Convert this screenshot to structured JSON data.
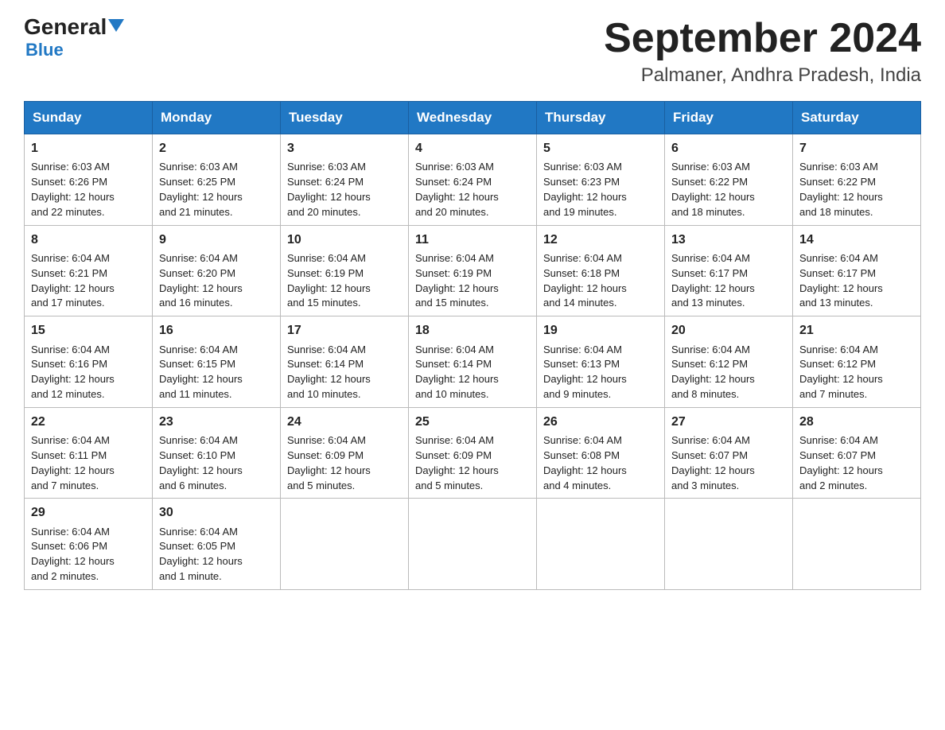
{
  "header": {
    "logo_general": "General",
    "logo_blue": "Blue",
    "month_title": "September 2024",
    "location": "Palmaner, Andhra Pradesh, India"
  },
  "days_of_week": [
    "Sunday",
    "Monday",
    "Tuesday",
    "Wednesday",
    "Thursday",
    "Friday",
    "Saturday"
  ],
  "weeks": [
    [
      {
        "day": "1",
        "sunrise": "6:03 AM",
        "sunset": "6:26 PM",
        "daylight": "12 hours and 22 minutes."
      },
      {
        "day": "2",
        "sunrise": "6:03 AM",
        "sunset": "6:25 PM",
        "daylight": "12 hours and 21 minutes."
      },
      {
        "day": "3",
        "sunrise": "6:03 AM",
        "sunset": "6:24 PM",
        "daylight": "12 hours and 20 minutes."
      },
      {
        "day": "4",
        "sunrise": "6:03 AM",
        "sunset": "6:24 PM",
        "daylight": "12 hours and 20 minutes."
      },
      {
        "day": "5",
        "sunrise": "6:03 AM",
        "sunset": "6:23 PM",
        "daylight": "12 hours and 19 minutes."
      },
      {
        "day": "6",
        "sunrise": "6:03 AM",
        "sunset": "6:22 PM",
        "daylight": "12 hours and 18 minutes."
      },
      {
        "day": "7",
        "sunrise": "6:03 AM",
        "sunset": "6:22 PM",
        "daylight": "12 hours and 18 minutes."
      }
    ],
    [
      {
        "day": "8",
        "sunrise": "6:04 AM",
        "sunset": "6:21 PM",
        "daylight": "12 hours and 17 minutes."
      },
      {
        "day": "9",
        "sunrise": "6:04 AM",
        "sunset": "6:20 PM",
        "daylight": "12 hours and 16 minutes."
      },
      {
        "day": "10",
        "sunrise": "6:04 AM",
        "sunset": "6:19 PM",
        "daylight": "12 hours and 15 minutes."
      },
      {
        "day": "11",
        "sunrise": "6:04 AM",
        "sunset": "6:19 PM",
        "daylight": "12 hours and 15 minutes."
      },
      {
        "day": "12",
        "sunrise": "6:04 AM",
        "sunset": "6:18 PM",
        "daylight": "12 hours and 14 minutes."
      },
      {
        "day": "13",
        "sunrise": "6:04 AM",
        "sunset": "6:17 PM",
        "daylight": "12 hours and 13 minutes."
      },
      {
        "day": "14",
        "sunrise": "6:04 AM",
        "sunset": "6:17 PM",
        "daylight": "12 hours and 13 minutes."
      }
    ],
    [
      {
        "day": "15",
        "sunrise": "6:04 AM",
        "sunset": "6:16 PM",
        "daylight": "12 hours and 12 minutes."
      },
      {
        "day": "16",
        "sunrise": "6:04 AM",
        "sunset": "6:15 PM",
        "daylight": "12 hours and 11 minutes."
      },
      {
        "day": "17",
        "sunrise": "6:04 AM",
        "sunset": "6:14 PM",
        "daylight": "12 hours and 10 minutes."
      },
      {
        "day": "18",
        "sunrise": "6:04 AM",
        "sunset": "6:14 PM",
        "daylight": "12 hours and 10 minutes."
      },
      {
        "day": "19",
        "sunrise": "6:04 AM",
        "sunset": "6:13 PM",
        "daylight": "12 hours and 9 minutes."
      },
      {
        "day": "20",
        "sunrise": "6:04 AM",
        "sunset": "6:12 PM",
        "daylight": "12 hours and 8 minutes."
      },
      {
        "day": "21",
        "sunrise": "6:04 AM",
        "sunset": "6:12 PM",
        "daylight": "12 hours and 7 minutes."
      }
    ],
    [
      {
        "day": "22",
        "sunrise": "6:04 AM",
        "sunset": "6:11 PM",
        "daylight": "12 hours and 7 minutes."
      },
      {
        "day": "23",
        "sunrise": "6:04 AM",
        "sunset": "6:10 PM",
        "daylight": "12 hours and 6 minutes."
      },
      {
        "day": "24",
        "sunrise": "6:04 AM",
        "sunset": "6:09 PM",
        "daylight": "12 hours and 5 minutes."
      },
      {
        "day": "25",
        "sunrise": "6:04 AM",
        "sunset": "6:09 PM",
        "daylight": "12 hours and 5 minutes."
      },
      {
        "day": "26",
        "sunrise": "6:04 AM",
        "sunset": "6:08 PM",
        "daylight": "12 hours and 4 minutes."
      },
      {
        "day": "27",
        "sunrise": "6:04 AM",
        "sunset": "6:07 PM",
        "daylight": "12 hours and 3 minutes."
      },
      {
        "day": "28",
        "sunrise": "6:04 AM",
        "sunset": "6:07 PM",
        "daylight": "12 hours and 2 minutes."
      }
    ],
    [
      {
        "day": "29",
        "sunrise": "6:04 AM",
        "sunset": "6:06 PM",
        "daylight": "12 hours and 2 minutes."
      },
      {
        "day": "30",
        "sunrise": "6:04 AM",
        "sunset": "6:05 PM",
        "daylight": "12 hours and 1 minute."
      },
      null,
      null,
      null,
      null,
      null
    ]
  ],
  "labels": {
    "sunrise_prefix": "Sunrise: ",
    "sunset_prefix": "Sunset: ",
    "daylight_prefix": "Daylight: "
  }
}
